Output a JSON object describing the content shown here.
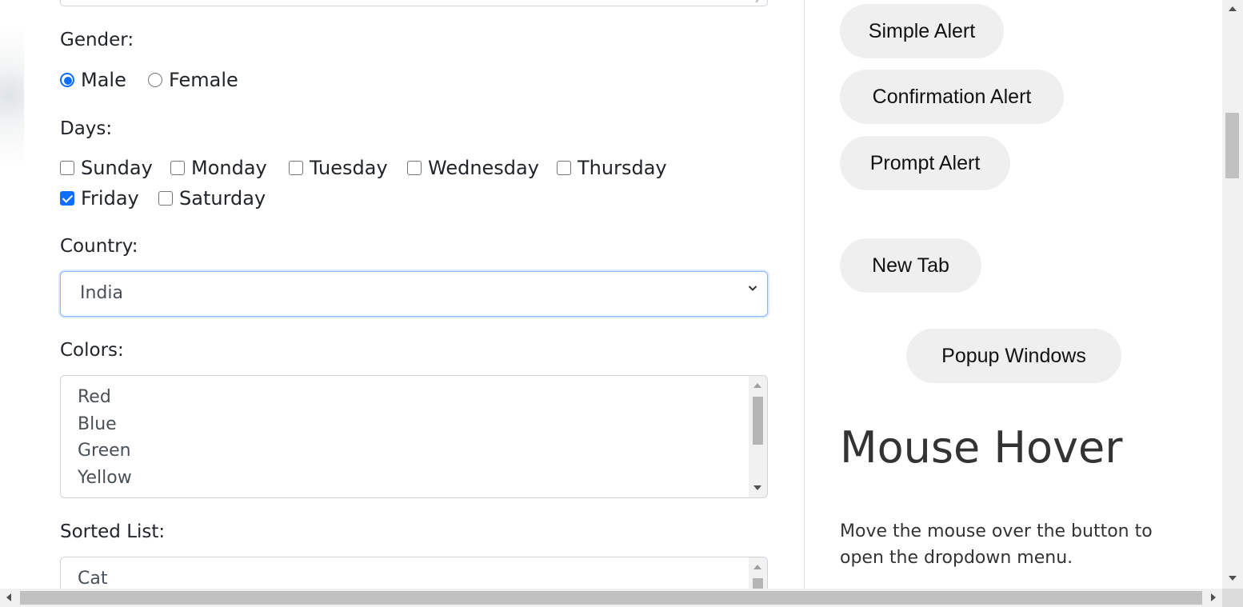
{
  "form": {
    "gender": {
      "label": "Gender:",
      "options": [
        {
          "label": "Male",
          "checked": true
        },
        {
          "label": "Female",
          "checked": false
        }
      ]
    },
    "days": {
      "label": "Days:",
      "options": [
        {
          "label": "Sunday",
          "checked": false
        },
        {
          "label": "Monday",
          "checked": false
        },
        {
          "label": "Tuesday",
          "checked": false
        },
        {
          "label": "Wednesday",
          "checked": false
        },
        {
          "label": "Thursday",
          "checked": false
        },
        {
          "label": "Friday",
          "checked": true
        },
        {
          "label": "Saturday",
          "checked": false
        }
      ]
    },
    "country": {
      "label": "Country:",
      "selected": "India"
    },
    "colors": {
      "label": "Colors:",
      "items": [
        "Red",
        "Blue",
        "Green",
        "Yellow"
      ]
    },
    "sorted_list": {
      "label": "Sorted List:",
      "items": [
        "Cat"
      ]
    }
  },
  "sidebar": {
    "buttons": {
      "simple_alert": "Simple Alert",
      "confirmation_alert": "Confirmation Alert",
      "prompt_alert": "Prompt Alert",
      "new_tab": "New Tab",
      "popup_windows": "Popup Windows"
    },
    "mouse_hover": {
      "title": "Mouse Hover",
      "description": "Move the mouse over the button to open the dropdown menu."
    }
  },
  "colors": {
    "accent": "#0d6efd",
    "button_bg": "#efefef",
    "focus_border": "#86b7fe"
  },
  "icons": {
    "select_arrow": "chevron-down-icon",
    "resize": "resize-grip-icon"
  }
}
